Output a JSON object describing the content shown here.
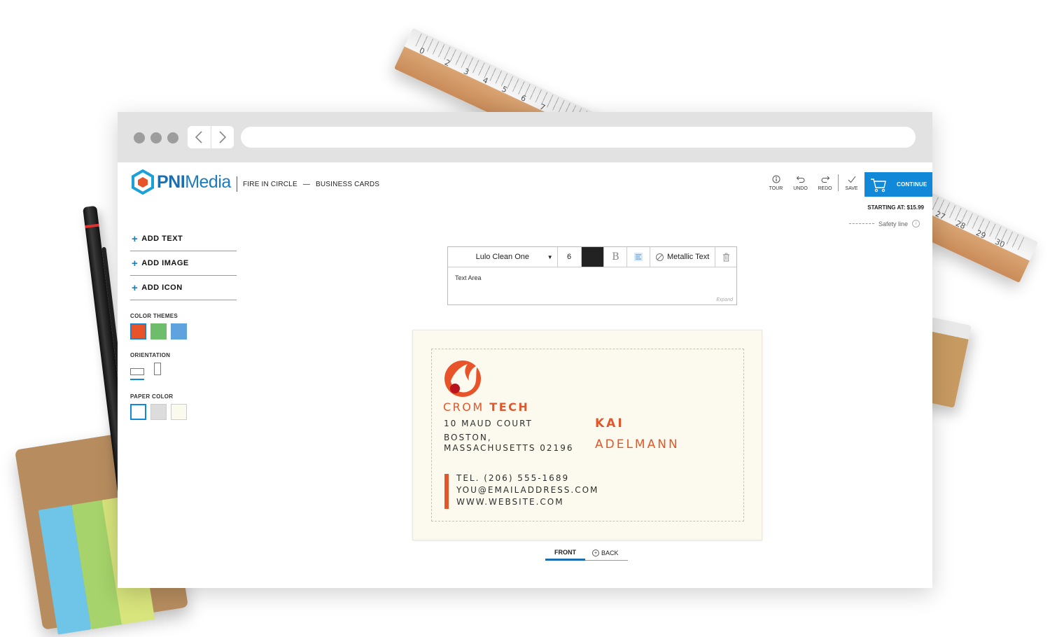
{
  "header": {
    "logo_prefix": "PNI",
    "logo_suffix": "Media",
    "breadcrumb_design": "FIRE IN CIRCLE",
    "breadcrumb_separator": "—",
    "breadcrumb_product": "BUSINESS CARDS",
    "tools": [
      {
        "label": "TOUR",
        "icon": "info-icon"
      },
      {
        "label": "UNDO",
        "icon": "undo-icon"
      },
      {
        "label": "REDO",
        "icon": "redo-icon"
      },
      {
        "label": "SAVE",
        "icon": "checkmark-icon"
      }
    ],
    "continue_label": "CONTINUE",
    "price": "STARTING AT: $15.99",
    "safety_line": "Safety line"
  },
  "sidebar": {
    "add_items": [
      {
        "label": "ADD TEXT"
      },
      {
        "label": "ADD IMAGE"
      },
      {
        "label": "ADD ICON"
      }
    ],
    "color_themes_label": "COLOR THEMES",
    "color_themes": [
      "#e8532a",
      "#6dbd6b",
      "#5ea3dd"
    ],
    "orientation_label": "ORIENTATION",
    "paper_color_label": "PAPER COLOR",
    "paper_colors": [
      "#ffffff",
      "#dcdcdc",
      "#fbfaee"
    ]
  },
  "editor": {
    "font": "Lulo Clean One",
    "size": "6",
    "text_color": "#222222",
    "bold_glyph": "B",
    "metallic_label": "Metallic Text",
    "text_area": "Text Area",
    "expand_label": "Expand"
  },
  "card": {
    "company_part1": "CROM",
    "company_part2": "TECH",
    "address_line1": "10 MAUD COURT",
    "address_line2": "BOSTON,",
    "address_line3": "MASSACHUSETTS 02196",
    "first_name": "KAI",
    "last_name": "ADELMANN",
    "phone": "TEL. (206) 555-1689",
    "email": "YOU@EMAILADDRESS.COM",
    "website": "WWW.WEBSITE.COM",
    "accent_color": "#e1572b",
    "paper_color": "#fcfaee"
  },
  "sides": {
    "front_label": "FRONT",
    "back_label": "BACK"
  }
}
